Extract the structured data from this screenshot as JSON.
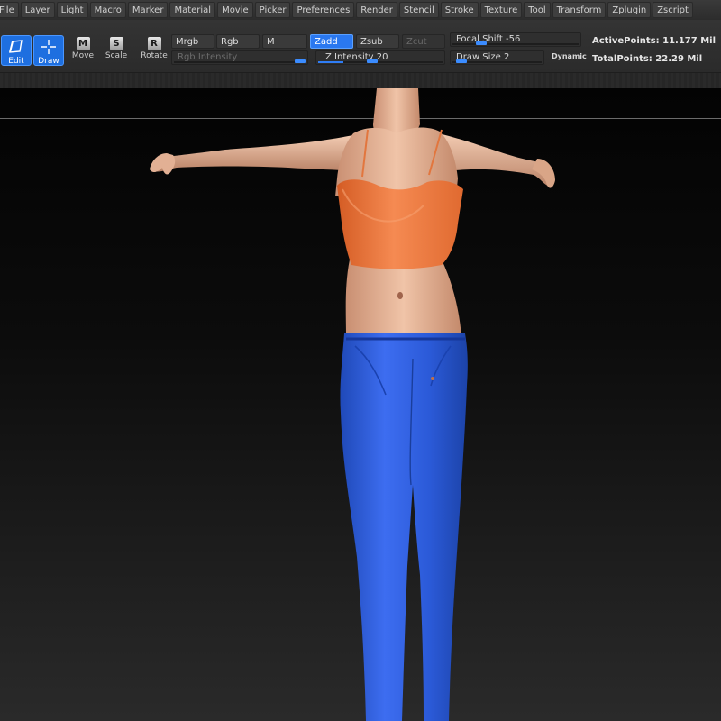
{
  "menu": {
    "items": [
      "File",
      "Layer",
      "Light",
      "Macro",
      "Marker",
      "Material",
      "Movie",
      "Picker",
      "Preferences",
      "Render",
      "Stencil",
      "Stroke",
      "Texture",
      "Tool",
      "Transform",
      "Zplugin",
      "Zscript"
    ]
  },
  "tools": {
    "edit_label": "Edit",
    "draw_label": "Draw",
    "move_label": "Move",
    "move_key": "M",
    "scale_label": "Scale",
    "scale_key": "S",
    "rotate_label": "Rotate",
    "rotate_key": "R"
  },
  "options": {
    "mrgb": "Mrgb",
    "rgb": "Rgb",
    "m": "M",
    "zadd": "Zadd",
    "zsub": "Zsub",
    "zcut": "Zcut",
    "rgb_intensity_label": "Rgb Intensity",
    "z_intensity_label": "Z Intensity",
    "z_intensity_value": "20",
    "focal_shift_label": "Focal Shift",
    "focal_shift_value": "-56",
    "draw_size_label": "Draw Size",
    "draw_size_value": "2",
    "dynamic_label": "Dynamic"
  },
  "stats": {
    "active_points": "ActivePoints: 11.177  Mil",
    "total_points": "TotalPoints: 22.29  Mil"
  },
  "colors": {
    "accent": "#2a78f0",
    "top_color": "#f07a3e",
    "jeans_color": "#2f5fd8",
    "skin_color": "#e8b79a"
  }
}
